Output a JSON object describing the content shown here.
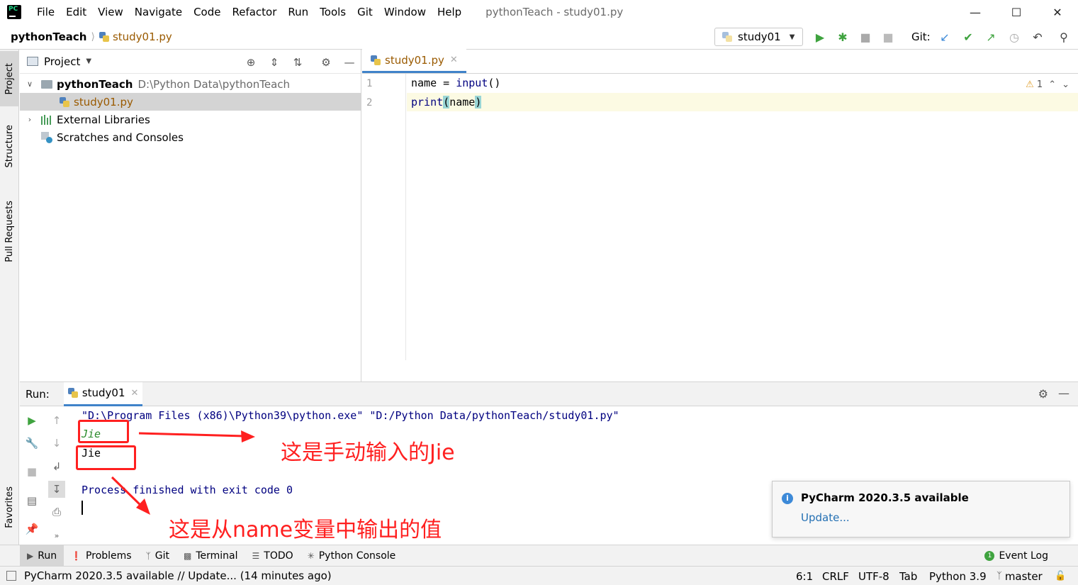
{
  "menubar": {
    "items": [
      "File",
      "Edit",
      "View",
      "Navigate",
      "Code",
      "Refactor",
      "Run",
      "Tools",
      "Git",
      "Window",
      "Help"
    ],
    "window_title": "pythonTeach - study01.py"
  },
  "navbar": {
    "project": "pythonTeach",
    "file": "study01.py",
    "run_config": "study01",
    "git_label": "Git:"
  },
  "left_strip": {
    "project": "Project",
    "structure": "Structure",
    "pull_requests": "Pull Requests",
    "favorites": "Favorites"
  },
  "project_panel": {
    "title": "Project",
    "tree": {
      "root_name": "pythonTeach",
      "root_path": "D:\\Python Data\\pythonTeach",
      "file": "study01.py",
      "external": "External Libraries",
      "scratches": "Scratches and Consoles"
    }
  },
  "editor": {
    "tab": "study01.py",
    "line_numbers": [
      "1",
      "2"
    ],
    "line1": {
      "name": "name",
      "op": " = ",
      "call": "input",
      "parens": "()"
    },
    "line2": {
      "call": "print",
      "open": "(",
      "arg": "name",
      "close": ")"
    },
    "warning_count": "1"
  },
  "run": {
    "label": "Run:",
    "tab": "study01",
    "console": {
      "command": "\"D:\\Program Files (x86)\\Python39\\python.exe\" \"D:/Python Data/pythonTeach/study01.py\"",
      "input": "Jie",
      "output": "Jie",
      "exit": "Process finished with exit code 0"
    }
  },
  "annotations": {
    "input_note": "这是手动输入的Jie",
    "output_note": "这是从name变量中输出的值",
    "color": "#ff2020"
  },
  "notification": {
    "title": "PyCharm 2020.3.5 available",
    "link": "Update..."
  },
  "bottom_tools": {
    "run": "Run",
    "problems": "Problems",
    "git": "Git",
    "terminal": "Terminal",
    "todo": "TODO",
    "python_console": "Python Console",
    "event_log": "Event Log"
  },
  "statusbar": {
    "message": "PyCharm 2020.3.5 available // Update... (14 minutes ago)",
    "position": "6:1",
    "line_sep": "CRLF",
    "encoding": "UTF-8",
    "indent": "Tab",
    "interpreter": "Python 3.9",
    "branch": "master"
  },
  "colors": {
    "accent": "#4083c9",
    "run_green": "#3fa33f",
    "link_blue": "#2470b3"
  }
}
